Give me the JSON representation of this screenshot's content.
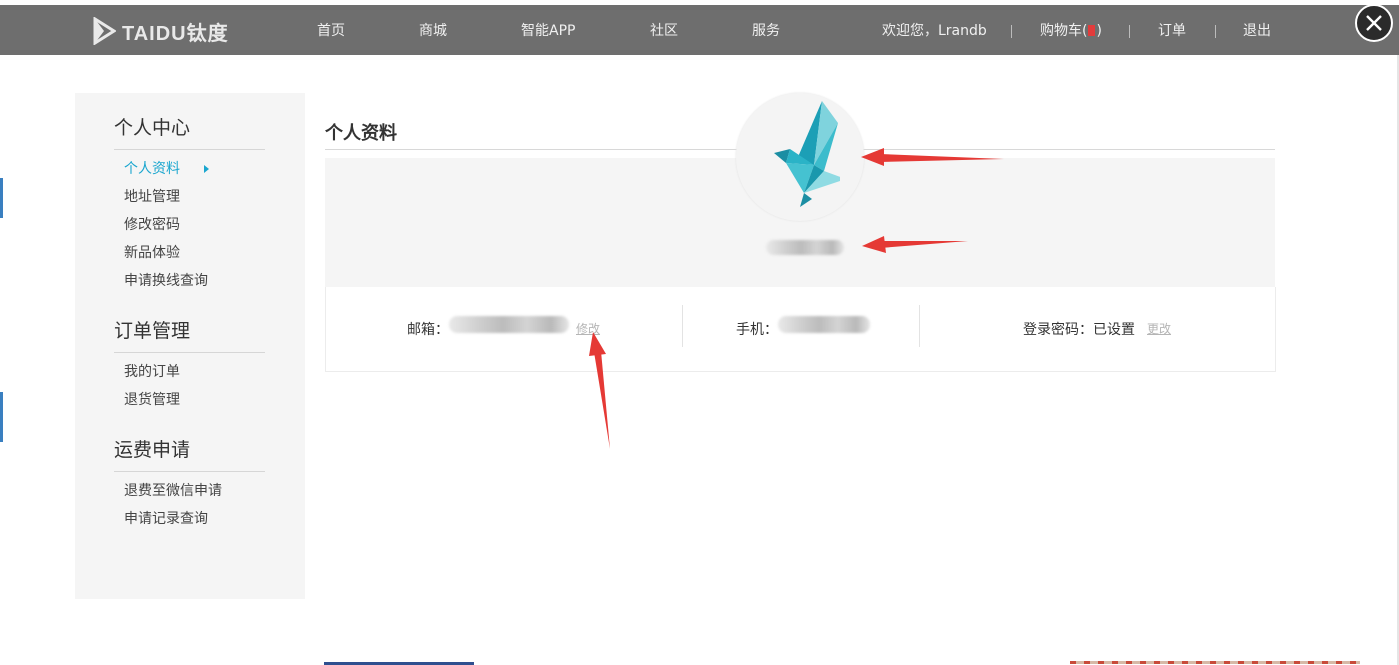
{
  "brand": {
    "logo_text": "TAIDU钛度"
  },
  "nav": {
    "items": [
      "首页",
      "商城",
      "智能APP",
      "社区",
      "服务"
    ],
    "welcome": "欢迎您，Lrandb",
    "cart_prefix": "购物车(",
    "cart_suffix": ")",
    "orders": "订单",
    "logout": "退出"
  },
  "sidebar": {
    "groups": [
      {
        "title": "个人中心",
        "items": [
          "个人资料",
          "地址管理",
          "修改密码",
          "新品体验",
          "申请换线查询"
        ]
      },
      {
        "title": "订单管理",
        "items": [
          "我的订单",
          "退货管理"
        ]
      },
      {
        "title": "运费申请",
        "items": [
          "退费至微信申请",
          "申请记录查询"
        ]
      }
    ],
    "active_item": "个人资料"
  },
  "main": {
    "title": "个人资料",
    "email_label": "邮箱：",
    "email_edit": "修改",
    "phone_label": "手机：",
    "password_label": "登录密码：已设置",
    "password_edit": "更改"
  },
  "colors": {
    "navbar": "#6e6e6e",
    "accent": "#1aa6cf",
    "annotation_arrow": "#e53935",
    "avatar_bird": "#2ab3c7"
  },
  "icons": {
    "logo": "taidu-play-logo-icon",
    "close": "close-icon",
    "active_marker": "caret-right-icon",
    "avatar": "origami-bird-icon"
  }
}
